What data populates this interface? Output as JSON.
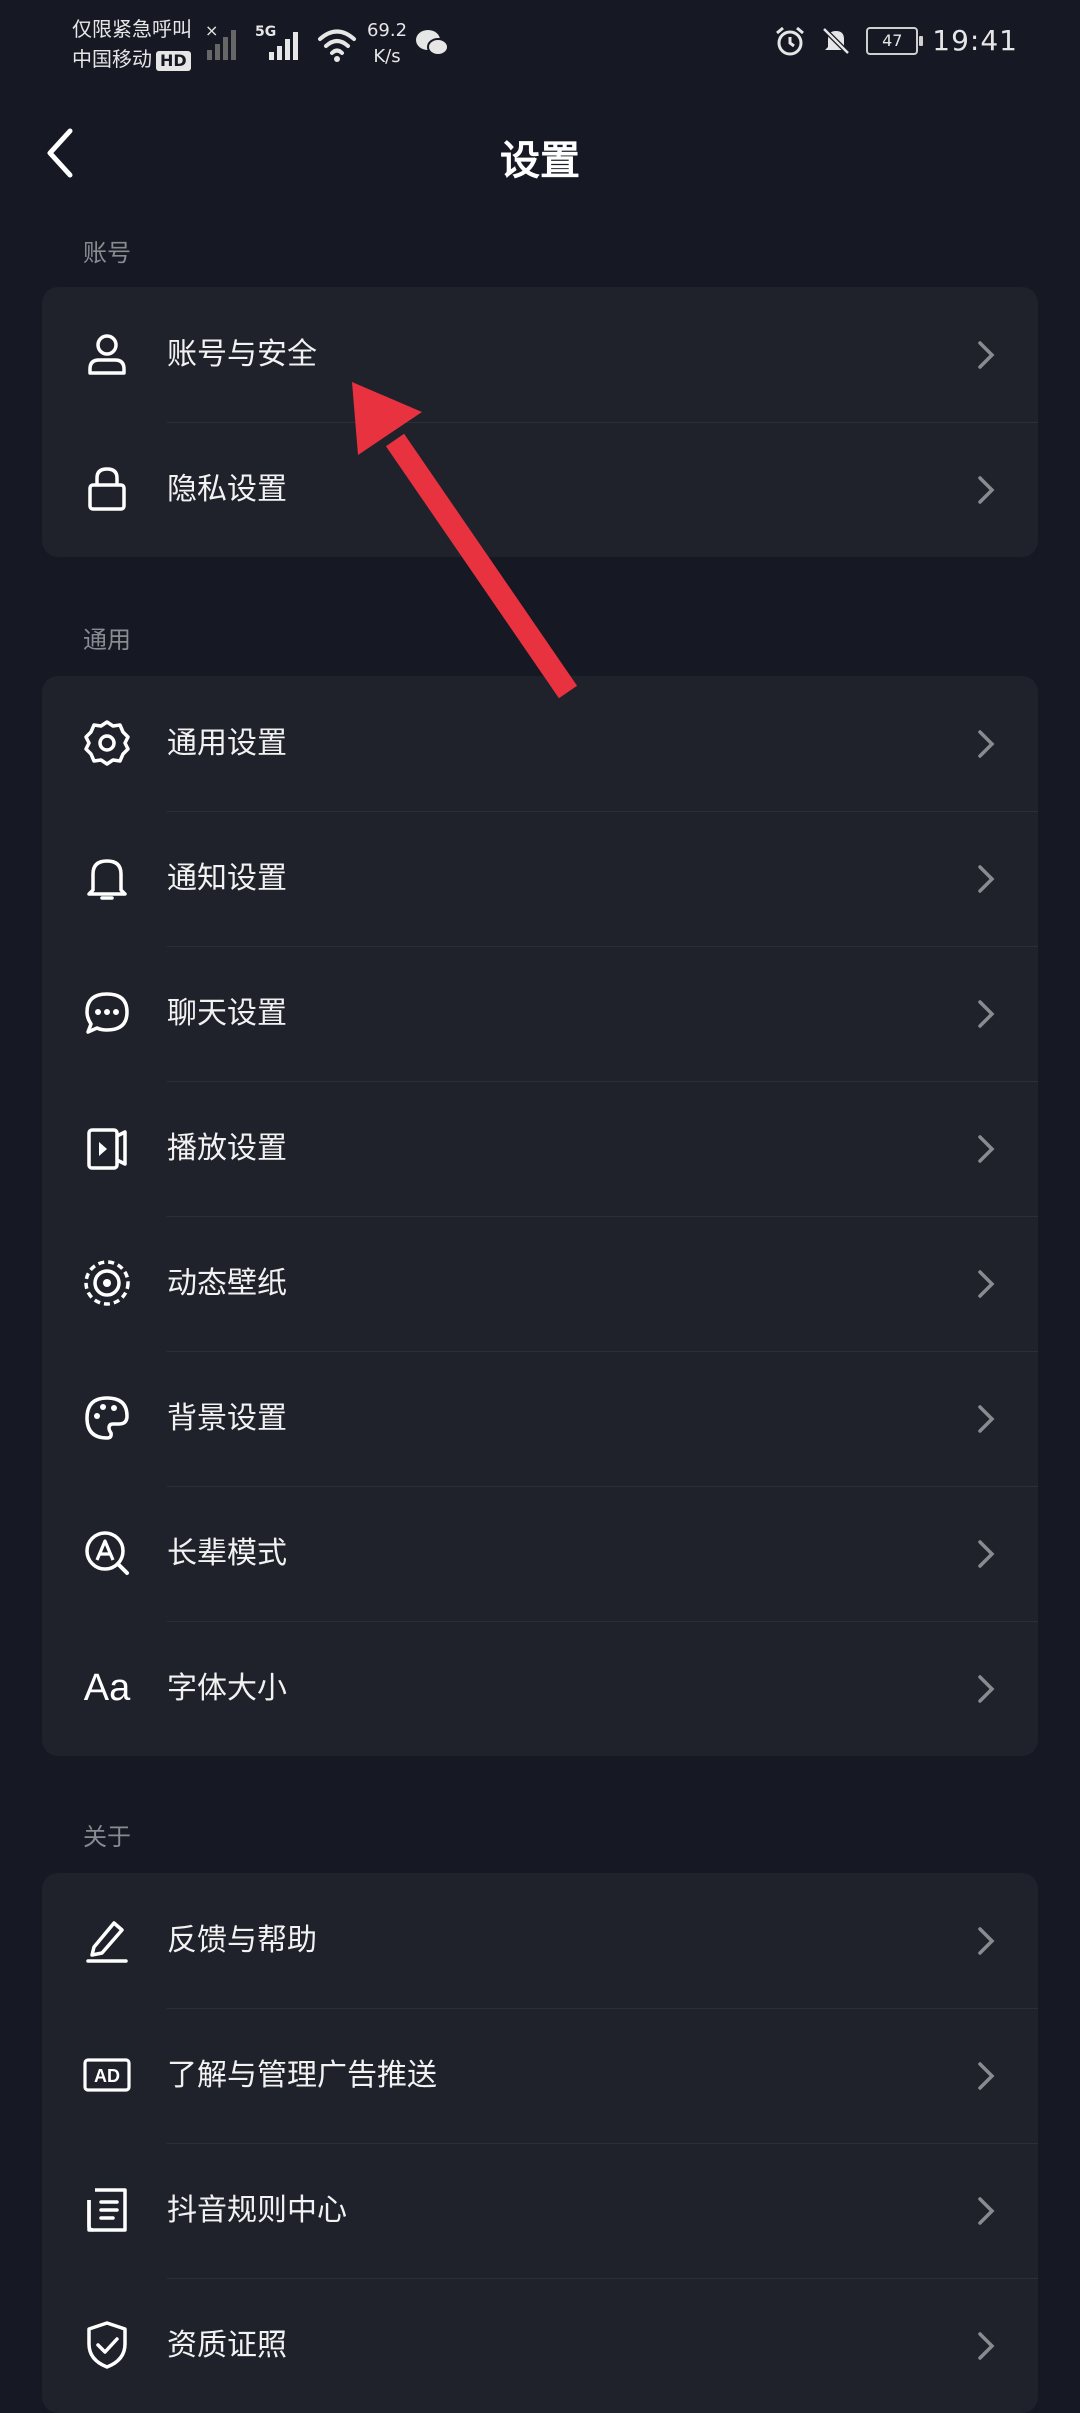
{
  "status_bar": {
    "carrier_line1": "仅限紧急呼叫",
    "carrier_line2": "中国移动",
    "hd": "HD",
    "network": "5G",
    "speed_value": "69.2",
    "speed_unit": "K/s",
    "battery": "47",
    "time": "19:41"
  },
  "header": {
    "title": "设置"
  },
  "sections": {
    "account": {
      "label": "账号",
      "items": [
        {
          "label": "账号与安全",
          "icon": "person-icon"
        },
        {
          "label": "隐私设置",
          "icon": "lock-icon"
        }
      ]
    },
    "general": {
      "label": "通用",
      "items": [
        {
          "label": "通用设置",
          "icon": "gear-icon"
        },
        {
          "label": "通知设置",
          "icon": "bell-icon"
        },
        {
          "label": "聊天设置",
          "icon": "chat-bubble-icon"
        },
        {
          "label": "播放设置",
          "icon": "play-icon"
        },
        {
          "label": "动态壁纸",
          "icon": "live-wallpaper-icon"
        },
        {
          "label": "背景设置",
          "icon": "palette-icon"
        },
        {
          "label": "长辈模式",
          "icon": "elder-mode-icon"
        },
        {
          "label": "字体大小",
          "icon": "font-size-icon",
          "icon_text": "Aa"
        }
      ]
    },
    "about": {
      "label": "关于",
      "items": [
        {
          "label": "反馈与帮助",
          "icon": "pencil-icon"
        },
        {
          "label": "了解与管理广告推送",
          "icon": "ad-icon",
          "icon_text": "AD"
        },
        {
          "label": "抖音规则中心",
          "icon": "document-icon"
        },
        {
          "label": "资质证照",
          "icon": "shield-check-icon"
        }
      ]
    }
  },
  "colors": {
    "background": "#161823",
    "card": "#1f212b",
    "annotation_arrow": "#e8323f"
  }
}
